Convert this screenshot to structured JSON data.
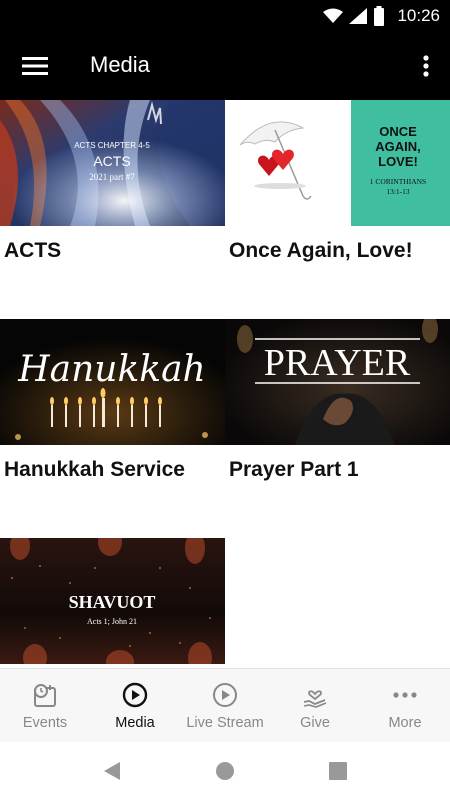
{
  "status_bar": {
    "time": "10:26"
  },
  "app_bar": {
    "title": "Media"
  },
  "media": [
    {
      "title": "ACTS",
      "thumb_lines": [
        "ACTS CHAPTER 4-5",
        "ACTS",
        "2021 part #7"
      ]
    },
    {
      "title": "Once Again, Love!",
      "thumb_lines": [
        "ONCE",
        "AGAIN,",
        "LOVE!",
        "1 CORINTHIANS",
        "13:1-13"
      ]
    },
    {
      "title": "Hanukkah Service",
      "thumb_lines": [
        "Hanukkah"
      ]
    },
    {
      "title": "Prayer Part 1",
      "thumb_lines": [
        "PRAYER"
      ]
    },
    {
      "title": "",
      "thumb_lines": [
        "SHAVUOT",
        "Acts 1; John 21"
      ]
    }
  ],
  "bottom_nav": [
    {
      "label": "Events",
      "icon": "calendar-clock-icon",
      "active": false
    },
    {
      "label": "Media",
      "icon": "play-circle-icon",
      "active": true
    },
    {
      "label": "Live Stream",
      "icon": "play-circle-icon",
      "active": false
    },
    {
      "label": "Give",
      "icon": "hand-heart-icon",
      "active": false
    },
    {
      "label": "More",
      "icon": "more-horizontal-icon",
      "active": false
    }
  ],
  "colors": {
    "app_bar": "#000000",
    "active_nav": "#111111",
    "inactive_nav": "#888888"
  }
}
